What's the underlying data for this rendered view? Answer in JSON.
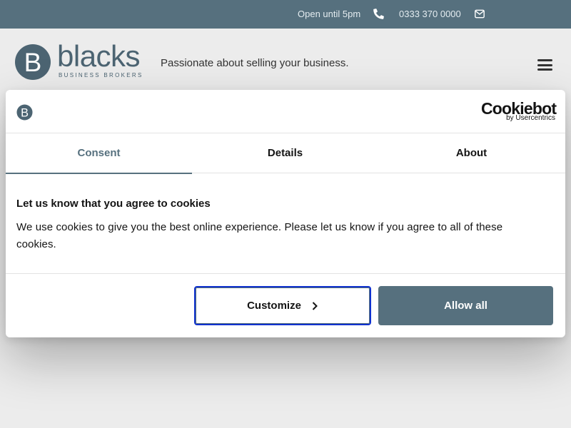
{
  "topbar": {
    "hours": "Open until 5pm",
    "phone": "0333 370 0000",
    "phone_icon": "phone-icon",
    "mail_icon": "envelope-icon"
  },
  "header": {
    "logo_word": "blacks",
    "logo_sub": "BUSINESS BROKERS",
    "tagline": "Passionate about selling your business.",
    "menu_icon": "hamburger-icon"
  },
  "cookie_dialog": {
    "brand_main": "Cookiebot",
    "brand_by": "by Usercentrics",
    "tabs": [
      {
        "label": "Consent",
        "active": true
      },
      {
        "label": "Details",
        "active": false
      },
      {
        "label": "About",
        "active": false
      }
    ],
    "title": "Let us know that you agree to cookies",
    "text": "We use cookies to give you the best online experience. Please let us know if you agree to all of these cookies.",
    "customize_label": "Customize",
    "allow_label": "Allow all"
  },
  "colors": {
    "brand": "#56707e",
    "focus_ring": "#1032cf",
    "page_bg": "#ececec"
  }
}
